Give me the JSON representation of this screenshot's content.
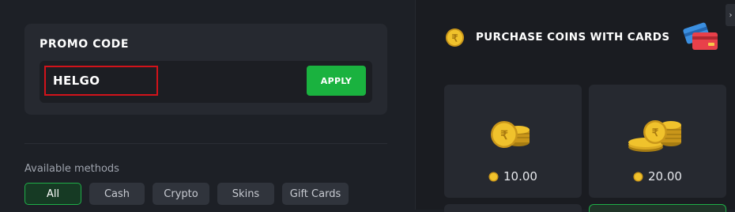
{
  "promo": {
    "title": "PROMO CODE",
    "input_value": "HELGO",
    "apply_label": "APPLY"
  },
  "methods": {
    "label": "Available methods",
    "items": [
      {
        "label": "All",
        "active": true
      },
      {
        "label": "Cash",
        "active": false
      },
      {
        "label": "Crypto",
        "active": false
      },
      {
        "label": "Skins",
        "active": false
      },
      {
        "label": "Gift Cards",
        "active": false
      }
    ]
  },
  "purchase": {
    "title": "PURCHASE COINS WITH CARDS",
    "coin_icon": "coin-icon",
    "cards_icon": "credit-cards-icon",
    "packs": [
      {
        "price": "10.00",
        "icon": "coin-stack-icon"
      },
      {
        "price": "20.00",
        "icon": "coin-pile-icon"
      }
    ]
  },
  "scroll_tab": {
    "label": "›"
  },
  "colors": {
    "accent_green": "#1ab23f",
    "input_border_red": "#d2131a",
    "coin_gold": "#e6b51d"
  }
}
